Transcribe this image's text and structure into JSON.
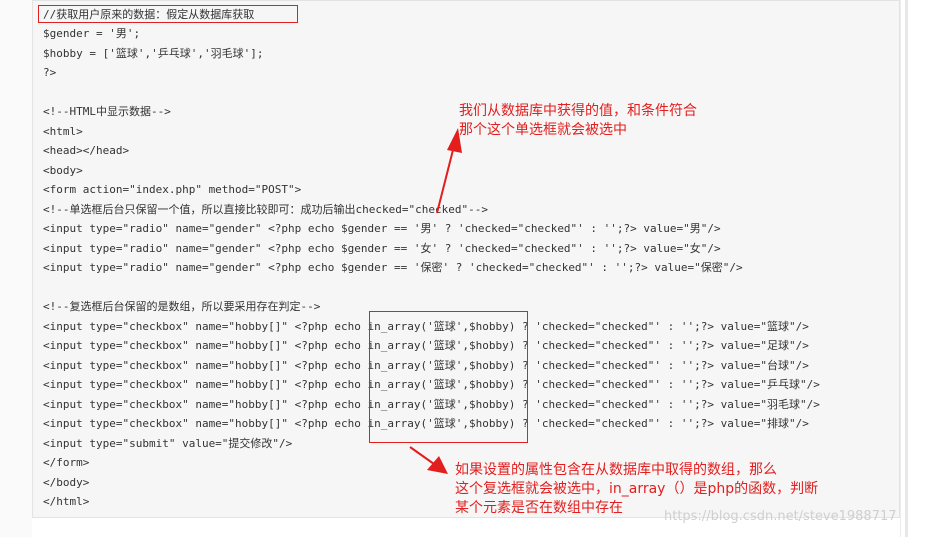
{
  "code": {
    "lines": [
      "//获取用户原来的数据：假定从数据库获取",
      "$gender = '男';",
      "$hobby = ['篮球','乒乓球','羽毛球'];",
      "?>",
      "",
      "<!--HTML中显示数据-->",
      "<html>",
      "<head></head>",
      "<body>",
      "<form action=\"index.php\" method=\"POST\">",
      "<!--单选框后台只保留一个值，所以直接比较即可：成功后输出checked=\"checked\"-->",
      "<input type=\"radio\" name=\"gender\" <?php echo $gender == '男' ? 'checked=\"checked\"' : '';?> value=\"男\"/>",
      "<input type=\"radio\" name=\"gender\" <?php echo $gender == '女' ? 'checked=\"checked\"' : '';?> value=\"女\"/>",
      "<input type=\"radio\" name=\"gender\" <?php echo $gender == '保密' ? 'checked=\"checked\"' : '';?> value=\"保密\"/>",
      "",
      "<!--复选框后台保留的是数组，所以要采用存在判定-->",
      "<input type=\"checkbox\" name=\"hobby[]\" <?php echo in_array('篮球',$hobby) ? 'checked=\"checked\"' : '';?> value=\"篮球\"/>",
      "<input type=\"checkbox\" name=\"hobby[]\" <?php echo in_array('篮球',$hobby) ? 'checked=\"checked\"' : '';?> value=\"足球\"/>",
      "<input type=\"checkbox\" name=\"hobby[]\" <?php echo in_array('篮球',$hobby) ? 'checked=\"checked\"' : '';?> value=\"台球\"/>",
      "<input type=\"checkbox\" name=\"hobby[]\" <?php echo in_array('篮球',$hobby) ? 'checked=\"checked\"' : '';?> value=\"乒乓球\"/>",
      "<input type=\"checkbox\" name=\"hobby[]\" <?php echo in_array('篮球',$hobby) ? 'checked=\"checked\"' : '';?> value=\"羽毛球\"/>",
      "<input type=\"checkbox\" name=\"hobby[]\" <?php echo in_array('篮球',$hobby) ? 'checked=\"checked\"' : '';?> value=\"排球\"/>",
      "<input type=\"submit\" value=\"提交修改\"/>",
      "</form>",
      "</body>",
      "</html>"
    ]
  },
  "annotations": {
    "note_radio_line1": "我们从数据库中获得的值，和条件符合",
    "note_radio_line2": "那个这个单选框就会被选中",
    "note_checkbox_line1": "如果设置的属性包含在从数据库中取得的数组，那么",
    "note_checkbox_line2": "这个复选框就会被选中，in_array（）是php的函数，判断",
    "note_checkbox_line3": "某个元素是否在数组中存在"
  },
  "watermark": "https://blog.csdn.net/steve1988717",
  "colors": {
    "annotation": "#e21e1e",
    "code_text": "#333333",
    "panel_background": "#f6f6f6"
  }
}
